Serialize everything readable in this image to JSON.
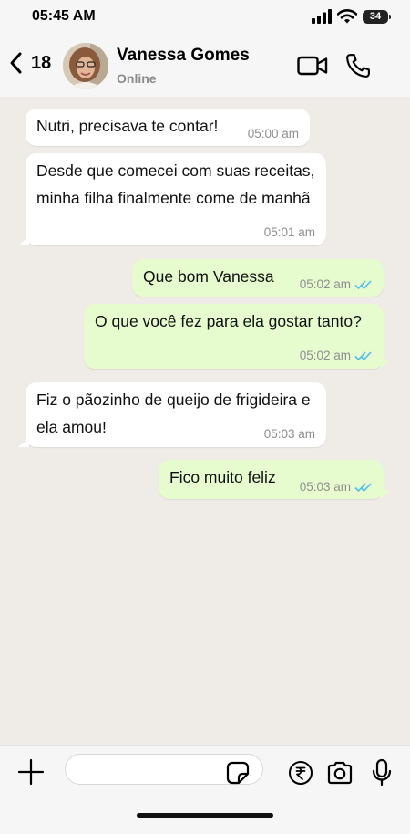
{
  "status_bar": {
    "time": "05:45 AM",
    "battery": "34"
  },
  "header": {
    "back_count": "18",
    "contact_name": "Vanessa Gomes",
    "contact_status": "Online"
  },
  "messages": [
    {
      "direction": "in",
      "text": "Nutri, precisava te contar!",
      "time": "05:00 am"
    },
    {
      "direction": "in",
      "text": "Desde que comecei com suas receitas, minha filha finalmente come de manhã",
      "time": "05:01 am"
    },
    {
      "direction": "out",
      "text": "Que bom Vanessa",
      "time": "05:02 am",
      "read": true
    },
    {
      "direction": "out",
      "text": "O que você fez para ela gostar tanto?",
      "time": "05:02 am",
      "read": true
    },
    {
      "direction": "in",
      "text": "Fiz o pãozinho de queijo de frigideira e ela amou!",
      "time": "05:03 am"
    },
    {
      "direction": "out",
      "text": "Fico muito feliz",
      "time": "05:03 am",
      "read": true
    }
  ],
  "input": {
    "value": "",
    "placeholder": ""
  },
  "icons": {
    "back": "chevron-left-icon",
    "video": "video-camera-icon",
    "call": "phone-icon",
    "plus": "plus-icon",
    "sticker": "sticker-icon",
    "payment": "rupee-icon",
    "camera": "camera-icon",
    "mic": "microphone-icon",
    "read_receipt": "double-check-icon"
  },
  "colors": {
    "incoming_bubble": "#ffffff",
    "outgoing_bubble": "#e6fccf",
    "chat_background": "#efebe6",
    "read_receipt": "#53bdeb"
  }
}
